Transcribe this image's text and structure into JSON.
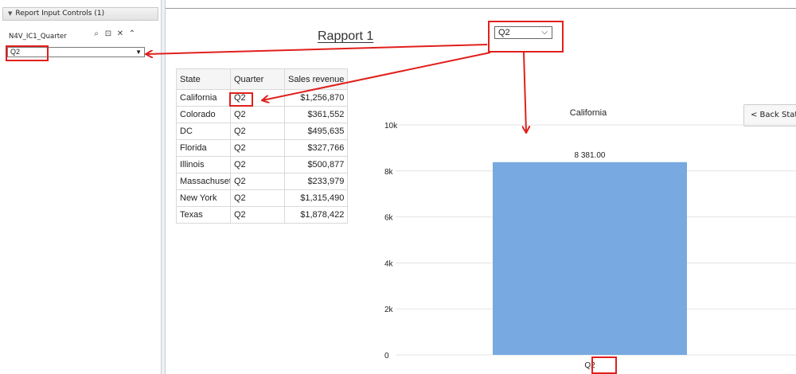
{
  "panel": {
    "header": "Report Input Controls (1)",
    "control_label": "N4V_IC1_Quarter",
    "control_value": "Q2",
    "icons": [
      "search-icon",
      "filter-icon",
      "close-icon",
      "collapse-icon"
    ]
  },
  "report": {
    "title": "Rapport 1",
    "top_selector_value": "Q2",
    "back_button": "< Back Stat",
    "table": {
      "headers": [
        "State",
        "Quarter",
        "Sales revenue"
      ],
      "rows": [
        [
          "California",
          "Q2",
          "$1,256,870"
        ],
        [
          "Colorado",
          "Q2",
          "$361,552"
        ],
        [
          "DC",
          "Q2",
          "$495,635"
        ],
        [
          "Florida",
          "Q2",
          "$327,766"
        ],
        [
          "Illinois",
          "Q2",
          "$500,877"
        ],
        [
          "Massachusett",
          "Q2",
          "$233,979"
        ],
        [
          "New York",
          "Q2",
          "$1,315,490"
        ],
        [
          "Texas",
          "Q2",
          "$1,878,422"
        ]
      ]
    }
  },
  "chart_data": {
    "type": "bar",
    "title": "California",
    "categories": [
      "Q2"
    ],
    "values": [
      8381
    ],
    "data_labels": [
      "8 381.00"
    ],
    "ylim": [
      0,
      10000
    ],
    "yticks": [
      0,
      2000,
      4000,
      6000,
      8000,
      10000
    ],
    "ytick_labels": [
      "0",
      "2k",
      "4k",
      "6k",
      "8k",
      "10k"
    ],
    "bar_color": "#78a9e0",
    "grid": true
  },
  "annotation_color": "#e0201c"
}
